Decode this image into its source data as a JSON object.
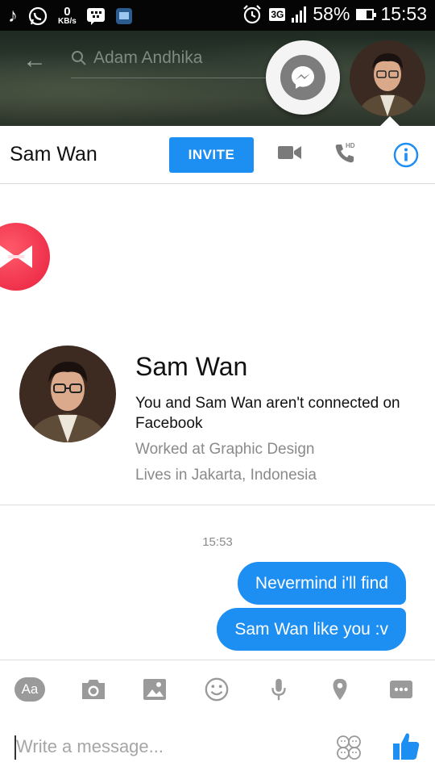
{
  "status_bar": {
    "speed_value": "0",
    "speed_unit": "KB/s",
    "network": "3G",
    "battery_percent": "58%",
    "battery_level": 0.58,
    "time": "15:53"
  },
  "chat_head": {
    "search_placeholder": "Adam Andhika"
  },
  "header": {
    "title": "Sam Wan",
    "invite_label": "INVITE",
    "hd_label": "HD"
  },
  "profile": {
    "name": "Sam Wan",
    "connection_note": "You and Sam Wan aren't connected on Facebook",
    "work": "Worked at Graphic Design",
    "location": "Lives in Jakarta, Indonesia"
  },
  "messages": {
    "timestamp": "15:53",
    "items": [
      {
        "text": "Nevermind i'll find"
      },
      {
        "text": "Sam Wan like you :v"
      }
    ]
  },
  "composer": {
    "aa_label": "Aa",
    "placeholder": "Write a message..."
  },
  "colors": {
    "accent": "#1d8ef2",
    "messenger_gray": "#7d7d7d",
    "zoom_red": "#e8203e"
  }
}
